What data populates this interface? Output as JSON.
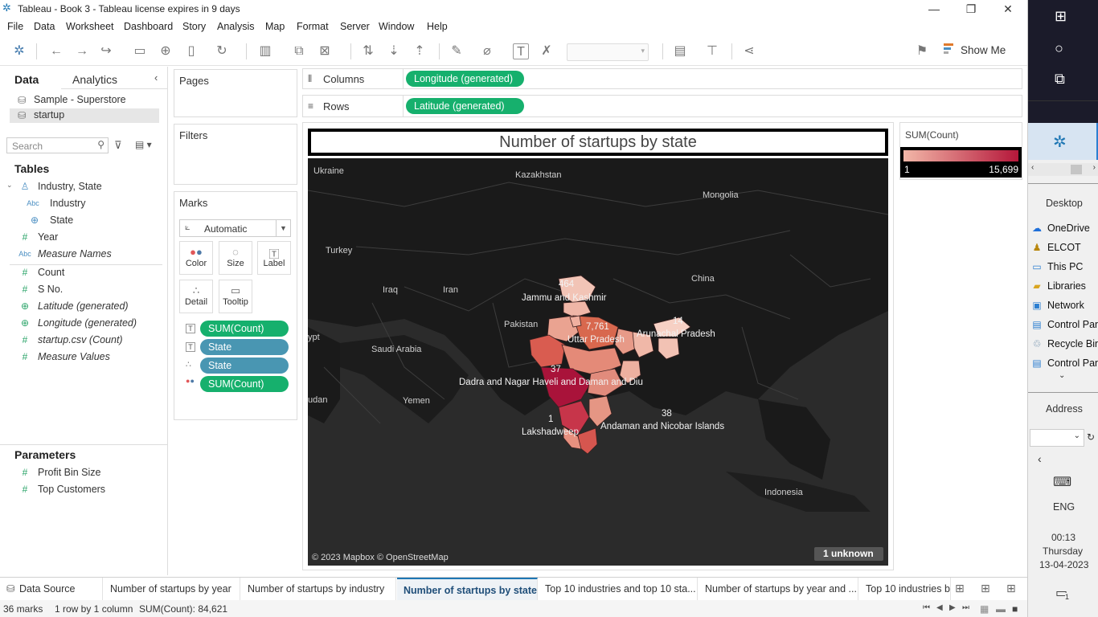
{
  "window": {
    "title": "Tableau - Book 3 - Tableau license expires in 9 days"
  },
  "menu": [
    "File",
    "Data",
    "Worksheet",
    "Dashboard",
    "Story",
    "Analysis",
    "Map",
    "Format",
    "Server",
    "Window",
    "Help"
  ],
  "toolbar": {
    "show_me_label": "Show Me"
  },
  "data_pane": {
    "tabs": [
      "Data",
      "Analytics"
    ],
    "data_sources": [
      "Sample - Superstore",
      "startup"
    ],
    "search_placeholder": "Search",
    "tables_heading": "Tables",
    "fields": [
      {
        "icon": "hierarchy",
        "label": "Industry, State"
      },
      {
        "icon": "Abc",
        "label": "Industry"
      },
      {
        "icon": "globe",
        "label": "State"
      },
      {
        "icon": "#",
        "label": "Year"
      },
      {
        "icon": "Abc",
        "label": "Measure Names"
      },
      {
        "icon": "#",
        "label": "Count"
      },
      {
        "icon": "#",
        "label": "S No."
      },
      {
        "icon": "globe",
        "label": "Latitude (generated)"
      },
      {
        "icon": "globe",
        "label": "Longitude (generated)"
      },
      {
        "icon": "#",
        "label": "startup.csv (Count)"
      },
      {
        "icon": "#",
        "label": "Measure Values"
      }
    ],
    "parameters_heading": "Parameters",
    "parameters": [
      "Profit Bin Size",
      "Top Customers"
    ]
  },
  "cards": {
    "pages": "Pages",
    "filters": "Filters",
    "marks": "Marks",
    "mark_type": "Automatic",
    "mark_buttons": [
      "Color",
      "Size",
      "Label",
      "Detail",
      "Tooltip"
    ],
    "mark_pills": [
      "SUM(Count)",
      "State",
      "State",
      "SUM(Count)"
    ]
  },
  "shelves": {
    "columns_label": "Columns",
    "columns_pill": "Longitude (generated)",
    "rows_label": "Rows",
    "rows_pill": "Latitude (generated)"
  },
  "view": {
    "title": "Number of startups by state",
    "geo_labels": [
      "Ukraine",
      "Kazakhstan",
      "Mongolia",
      "Turkey",
      "Iraq",
      "Iran",
      "China",
      "Pakistan",
      "Saudi Arabia",
      "Yemen",
      "Indonesia",
      "ypt",
      "udan"
    ],
    "state_labels": [
      {
        "name": "Jammu and Kashmir",
        "value": "464"
      },
      {
        "name": "Uttar Pradesh",
        "value": "7,761"
      },
      {
        "name": "Arunachal Pradesh",
        "value": "14"
      },
      {
        "name": "Dadra and Nagar Haveli and Daman and Diu",
        "value": "37"
      },
      {
        "name": "Lakshadweep",
        "value": "1"
      },
      {
        "name": "Andaman and Nicobar Islands",
        "value": "38"
      }
    ],
    "attribution": "© 2023 Mapbox © OpenStreetMap",
    "unknown_badge": "1 unknown"
  },
  "legend": {
    "title": "SUM(Count)",
    "min": "1",
    "max": "15,699",
    "color_low": "#f2b7a8",
    "color_high": "#b5173a"
  },
  "sheet_tabs": [
    "Data Source",
    "Number of startups by year",
    "Number of startups by industry",
    "Number of startups by state",
    "Top 10 industries and top 10 sta...",
    "Number of startups by year and ...",
    "Top 10 industries  b"
  ],
  "status": {
    "marks": "36 marks",
    "rows": "1 row by 1 column",
    "sum": "SUM(Count): 84,621"
  },
  "taskbar": {
    "desktop_label": "Desktop",
    "items": [
      "OneDrive",
      "ELCOT",
      "This PC",
      "Libraries",
      "Network",
      "Control Panel",
      "Recycle Bin",
      "Control Panel"
    ],
    "address_label": "Address",
    "language": "ENG",
    "time": "00:13",
    "day": "Thursday",
    "date": "13-04-2023",
    "notification_count": "1"
  }
}
